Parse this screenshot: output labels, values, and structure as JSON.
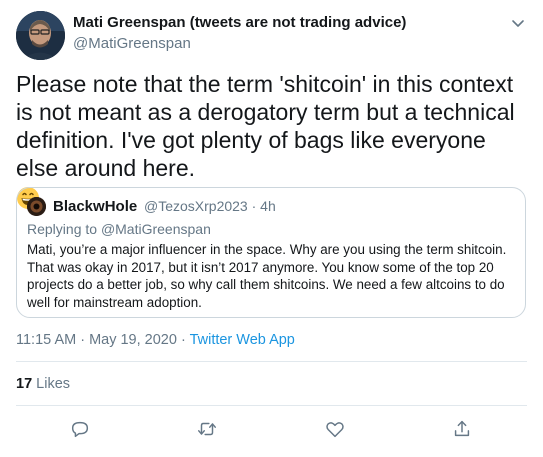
{
  "author": {
    "name": "Mati Greenspan (tweets are not trading advice)",
    "handle": "@MatiGreenspan"
  },
  "tweet": {
    "text": "Please note that the term 'shitcoin' in this context is not meant as a derogatory term but a technical definition. I've got plenty of bags like everyone else around here.",
    "emoji": "grinning-face-emoji"
  },
  "quoted": {
    "name": "BlackwHole",
    "handle_time": "@TezosXrp2023 · 4h",
    "replying_prefix": "Replying to ",
    "replying_to": "@MatiGreenspan",
    "text": "Mati, you’re a major influencer in the space.  Why are you using the term shitcoin.  That was okay in 2017, but it isn’t 2017 anymore.  You know some of the top 20 projects do a better job, so why call them shitcoins.  We need a few altcoins to do well for mainstream adoption."
  },
  "meta": {
    "time_date": "11:15 AM · May 19, 2020 · ",
    "app": "Twitter Web App"
  },
  "stats": {
    "likes_count": "17",
    "likes_label": "Likes"
  },
  "actions": [
    "reply-icon",
    "retweet-icon",
    "like-icon",
    "share-icon"
  ],
  "colors": {
    "link": "#1b95e0",
    "secondary_text": "#657786",
    "border": "#ccd6dd",
    "primary_text": "#14171a"
  }
}
